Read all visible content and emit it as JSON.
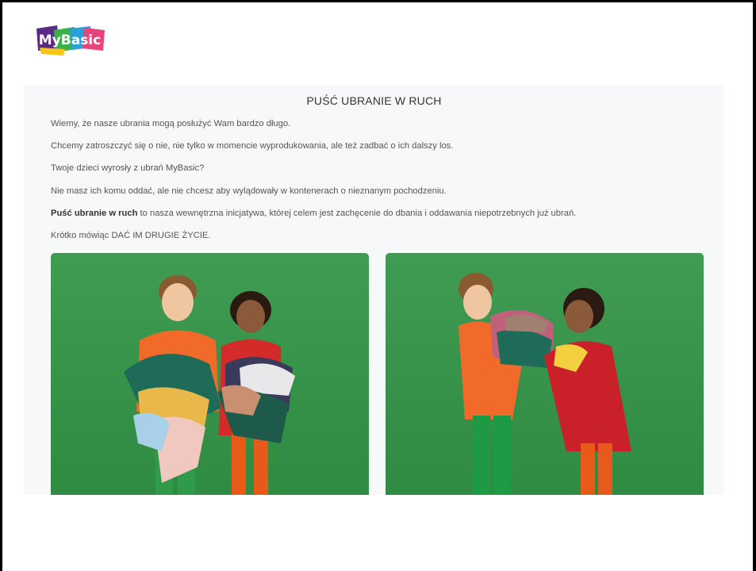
{
  "brand": {
    "logo_text": "MyBasic",
    "colors": {
      "purple": "#5b2a86",
      "pink": "#e8437a",
      "yellow": "#f5c518",
      "blue": "#2a9fd8",
      "green": "#3dae4a"
    }
  },
  "article": {
    "title": "PUŚĆ UBRANIE W RUCH",
    "paragraphs": [
      "Wiemy, że nasze ubrania mogą posłużyć Wam bardzo długo.",
      "Chcemy zatroszczyć się o nie, nie tylko w momencie wyprodukowania, ale też zadbać o ich dalszy los.",
      "Twoje dzieci wyrosły z ubrań MyBasic?",
      "Nie masz ich komu oddać, ale nie chcesz aby wylądowały w kontenerach o nieznanym pochodzeniu."
    ],
    "initiative": {
      "bold": "Puść ubranie w ruch",
      "rest": " to nasza wewnętrzna inicjatywa, której celem jest zachęcenie do dbania i oddawania niepotrzebnych już ubrań."
    },
    "closing": "Krótko mówiąc DAĆ IM DRUGIE ŻYCIE."
  },
  "photos": {
    "background_color": "#3a9a4c"
  }
}
